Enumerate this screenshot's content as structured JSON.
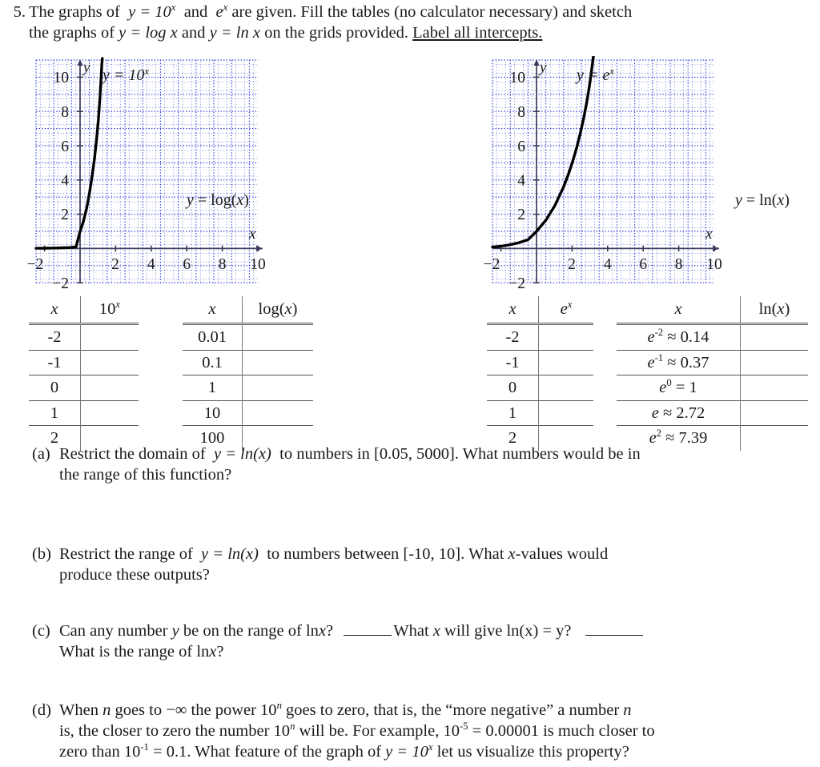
{
  "problem": {
    "number": "5.",
    "line1_a": "The graphs of",
    "line1_fn1": "y = 10",
    "line1_exp1": "x",
    "line1_b": "and",
    "line1_fn2": "e",
    "line1_exp2": "x",
    "line1_c": "are given. Fill the tables (no calculator necessary) and sketch",
    "line2_a": "the graphs of",
    "line2_fn1": "y = log x",
    "line2_b": "and",
    "line2_fn2": "y = ln x",
    "line2_c": "on the grids provided.",
    "line2_underlined": "Label all intercepts."
  },
  "graphs": {
    "left": {
      "curve_label": "y = 10",
      "curve_label_exp": "x",
      "aux_label": "y = log(x)",
      "axis_x_label": "x",
      "axis_y_label": "y",
      "x_ticks": [
        "-2",
        "2",
        "4",
        "6",
        "8",
        "10"
      ],
      "y_ticks": [
        "10",
        "8",
        "6",
        "4",
        "2",
        "-2"
      ],
      "xlim": [
        -2.5,
        10.5
      ],
      "ylim": [
        -2.5,
        10.5
      ],
      "grid_color": "#2b3ed6",
      "curve_color": "#000000",
      "axis_color": "#3a3a5a"
    },
    "right": {
      "curve_label": "y = e",
      "curve_label_exp": "x",
      "aux_label": "y = ln(x)",
      "axis_x_label": "x",
      "axis_y_label": "y",
      "x_ticks": [
        "-2",
        "2",
        "4",
        "6",
        "8",
        "10"
      ],
      "y_ticks": [
        "10",
        "8",
        "6",
        "4",
        "2",
        "-2"
      ],
      "xlim": [
        -2.5,
        10.5
      ],
      "ylim": [
        -2.5,
        10.5
      ],
      "grid_color": "#2b3ed6",
      "curve_color": "#000000",
      "axis_color": "#3a3a5a"
    }
  },
  "chart_data": [
    {
      "type": "line",
      "title": "y = 10^x",
      "xlabel": "x",
      "ylabel": "y",
      "xlim": [
        -2.5,
        10.5
      ],
      "ylim": [
        -2.5,
        10.5
      ],
      "grid": true,
      "series": [
        {
          "name": "y = 10^x",
          "formula": "10^x",
          "points": [
            [
              -2.5,
              0.003
            ],
            [
              -2.0,
              0.01
            ],
            [
              -1.5,
              0.032
            ],
            [
              -1.0,
              0.1
            ],
            [
              -0.5,
              0.316
            ],
            [
              0.0,
              1.0
            ],
            [
              0.5,
              3.162
            ],
            [
              1.0,
              10.0
            ]
          ]
        }
      ],
      "annotations": [
        "y = 10^x",
        "y = log(x)"
      ]
    },
    {
      "type": "line",
      "title": "y = e^x",
      "xlabel": "x",
      "ylabel": "y",
      "xlim": [
        -2.5,
        10.5
      ],
      "ylim": [
        -2.5,
        10.5
      ],
      "grid": true,
      "series": [
        {
          "name": "y = e^x",
          "formula": "e^x",
          "points": [
            [
              -2.5,
              0.082
            ],
            [
              -2.0,
              0.135
            ],
            [
              -1.5,
              0.223
            ],
            [
              -1.0,
              0.368
            ],
            [
              -0.5,
              0.607
            ],
            [
              0.0,
              1.0
            ],
            [
              0.5,
              1.649
            ],
            [
              1.0,
              2.718
            ],
            [
              1.5,
              4.482
            ],
            [
              2.0,
              7.389
            ],
            [
              2.303,
              10.0
            ]
          ]
        }
      ],
      "annotations": [
        "y = e^x",
        "y = ln(x)"
      ]
    }
  ],
  "tables": {
    "t1": {
      "headers": [
        "x",
        "10^x"
      ],
      "header_base": "10",
      "header_exp": "x",
      "rows": [
        [
          "-2",
          ""
        ],
        [
          "-1",
          ""
        ],
        [
          "0",
          ""
        ],
        [
          "1",
          ""
        ],
        [
          "2",
          ""
        ]
      ]
    },
    "t2": {
      "headers": [
        "x",
        "log(x)"
      ],
      "rows": [
        [
          "0.01",
          ""
        ],
        [
          "0.1",
          ""
        ],
        [
          "1",
          ""
        ],
        [
          "10",
          ""
        ],
        [
          "100",
          ""
        ]
      ]
    },
    "t3": {
      "headers": [
        "x",
        "e^x"
      ],
      "header_base": "e",
      "header_exp": "x",
      "rows": [
        [
          "-2",
          ""
        ],
        [
          "-1",
          ""
        ],
        [
          "0",
          ""
        ],
        [
          "1",
          ""
        ],
        [
          "2",
          ""
        ]
      ]
    },
    "t4": {
      "headers": [
        "x",
        "ln(x)"
      ],
      "rows": [
        {
          "base": "e",
          "exp": "-2",
          "rel": "≈",
          "val": "0.14"
        },
        {
          "base": "e",
          "exp": "-1",
          "rel": "≈",
          "val": "0.37"
        },
        {
          "base": "e",
          "exp": "0",
          "rel": "=",
          "val": "1"
        },
        {
          "base": "e",
          "exp": "",
          "rel": "≈",
          "val": "2.72"
        },
        {
          "base": "e",
          "exp": "2",
          "rel": "≈",
          "val": "7.39"
        }
      ]
    }
  },
  "subquestions": {
    "a": {
      "label": "(a)",
      "t1": "Restrict the domain of",
      "fn": "y = ln(x)",
      "t2": "to numbers in",
      "interval": "[0.05, 5000]",
      "t3": ". What numbers would be in",
      "line2": "the range of this function?"
    },
    "b": {
      "label": "(b)",
      "t1": "Restrict the range of",
      "fn": "y = ln(x)",
      "t2": "to numbers between",
      "interval": "[-10, 10]",
      "t3": ". What",
      "t4": "x",
      "t5": "-values would",
      "line2": "produce these outputs?"
    },
    "c": {
      "label": "(c)",
      "t1": "Can any number",
      "v1": "y",
      "t2": "be on the range of ln",
      "v2": "x",
      "t3": "?",
      "t4": "What",
      "v3": "x",
      "t5": "will give ln(x) = y?",
      "line2_a": "What is the range of ln",
      "line2_v": "x",
      "line2_b": "?"
    },
    "d": {
      "label": "(d)",
      "t1": "When",
      "v1": "n",
      "t2": "goes to −∞ the power 10",
      "exp1": "n",
      "t3": "goes to zero, that is, the “more negative” a number",
      "v2": "n",
      "line2_a": "is, the closer to zero the number 10",
      "line2_exp": "n",
      "line2_b": "will be. For example, 10",
      "line2_exp2": "-5",
      "line2_c": "= 0.00001 is much closer to",
      "line3_a": "zero than 10",
      "line3_exp": "-1",
      "line3_b": "= 0.1. What feature of the graph of",
      "line3_fn": "y = 10",
      "line3_fn_exp": "x",
      "line3_c": "let us visualize this property?"
    }
  }
}
